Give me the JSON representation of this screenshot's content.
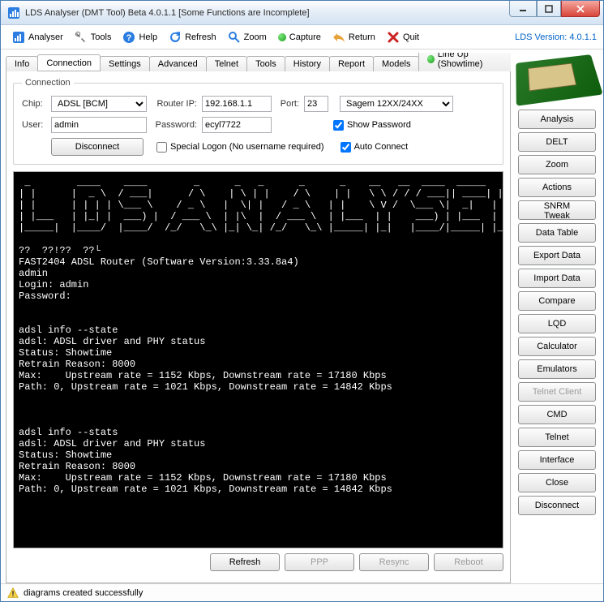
{
  "window": {
    "title": "LDS Analyser (DMT Tool) Beta 4.0.1.1 [Some Functions are Incomplete]"
  },
  "toolbar": {
    "analyser": "Analyser",
    "tools": "Tools",
    "help": "Help",
    "refresh": "Refresh",
    "zoom": "Zoom",
    "capture": "Capture",
    "return": "Return",
    "quit": "Quit",
    "version": "LDS Version: 4.0.1.1"
  },
  "tabs": {
    "info": "Info",
    "connection": "Connection",
    "settings": "Settings",
    "advanced": "Advanced",
    "telnet": "Telnet",
    "tools": "Tools",
    "history": "History",
    "report": "Report",
    "models": "Models",
    "lineup": "Line Up (Showtime)"
  },
  "conn": {
    "legend": "Connection",
    "chip_lbl": "Chip:",
    "chip_val": "ADSL [BCM]",
    "router_lbl": "Router IP:",
    "router_val": "192.168.1.1",
    "port_lbl": "Port:",
    "port_val": "23",
    "model_val": "Sagem 12XX/24XX",
    "user_lbl": "User:",
    "user_val": "admin",
    "pass_lbl": "Password:",
    "pass_val": "ecyl7722",
    "showpw": "Show Password",
    "disconnect": "Disconnect",
    "special": "Special Logon (No username required)",
    "auto": "Auto Connect"
  },
  "terminal": " _        ____    ____        _      _   _      _      _    __   __  ____  _____   ___  \n| |      |  _ \\  / ___|      / \\    | \\ | |    / \\    | |   \\ \\ / / / ___|| ____| |  _ \\ \n| |      | | | | \\___ \\    / _ \\   |  \\| |   / _ \\   | |    \\ V /  \\___ \\|  _|   | |_) |\n| |___   | |_| |  ___) |  / ___ \\  | |\\  |  / ___ \\  | |___  | |    ___) | |___  |  _ < \n|_____|  |____/  |____/  /_/   \\_\\ |_| \\_| /_/   \\_\\ |_____| |_|   |____/|_____| |_| \\_\\\n\n??  ??!??  ??└\nFAST2404 ADSL Router (Software Version:3.33.8a4)\nadmin\nLogin: admin\nPassword:\n\n\nadsl info --state\nadsl: ADSL driver and PHY status\nStatus: Showtime\nRetrain Reason: 8000\nMax:    Upstream rate = 1152 Kbps, Downstream rate = 17180 Kbps\nPath: 0, Upstream rate = 1021 Kbps, Downstream rate = 14842 Kbps\n\n\n\nadsl info --stats\nadsl: ADSL driver and PHY status\nStatus: Showtime\nRetrain Reason: 8000\nMax:    Upstream rate = 1152 Kbps, Downstream rate = 17180 Kbps\nPath: 0, Upstream rate = 1021 Kbps, Downstream rate = 14842 Kbps\n",
  "bottom": {
    "refresh": "Refresh",
    "ppp": "PPP",
    "resync": "Resync",
    "reboot": "Reboot"
  },
  "side": [
    "Analysis",
    "DELT",
    "Zoom",
    "Actions",
    "SNRM Tweak",
    "Data Table",
    "Export Data",
    "Import Data",
    "Compare",
    "LQD",
    "Calculator",
    "Emulators",
    "Telnet Client",
    "CMD",
    "Telnet",
    "Interface",
    "Close",
    "Disconnect"
  ],
  "status": "diagrams created successfully"
}
